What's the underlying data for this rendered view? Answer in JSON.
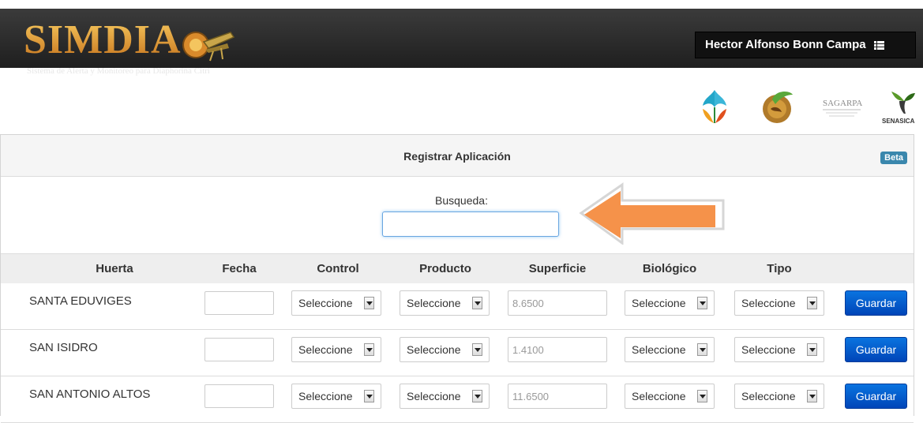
{
  "header": {
    "logo_text": "SIMDIA",
    "logo_subtitle": "Sistema de Alerta y Monitoreo para Diaphorina Citri",
    "user_name": "Hector Alfonso Bonn Campa",
    "user_menu_icon": "list-icon"
  },
  "partner_logos": {
    "sagarpa_label": "SAGARPA",
    "senasica_label": "SENASICA"
  },
  "panel": {
    "title": "Registrar Aplicación",
    "badge": "Beta"
  },
  "search": {
    "label": "Busqueda:",
    "value": ""
  },
  "table": {
    "columns": [
      "Huerta",
      "Fecha",
      "Control",
      "Producto",
      "Superficie",
      "Biológico",
      "Tipo"
    ],
    "rows": [
      {
        "huerta": "SANTA EDUVIGES",
        "fecha": "",
        "control": "Seleccione",
        "producto": "Seleccione",
        "superficie": "8.6500",
        "biologico": "Seleccione",
        "tipo": "Seleccione",
        "action": "Guardar"
      },
      {
        "huerta": "SAN ISIDRO",
        "fecha": "",
        "control": "Seleccione",
        "producto": "Seleccione",
        "superficie": "1.4100",
        "biologico": "Seleccione",
        "tipo": "Seleccione",
        "action": "Guardar"
      },
      {
        "huerta": "SAN ANTONIO ALTOS",
        "fecha": "",
        "control": "Seleccione",
        "producto": "Seleccione",
        "superficie": "11.6500",
        "biologico": "Seleccione",
        "tipo": "Seleccione",
        "action": "Guardar"
      }
    ]
  },
  "colors": {
    "header_bg": "#2b2b2b",
    "logo_gold": "#e8a533",
    "primary_button": "#0a5fd6",
    "beta_badge": "#3a87ad",
    "callout_arrow": "#f5924a"
  }
}
